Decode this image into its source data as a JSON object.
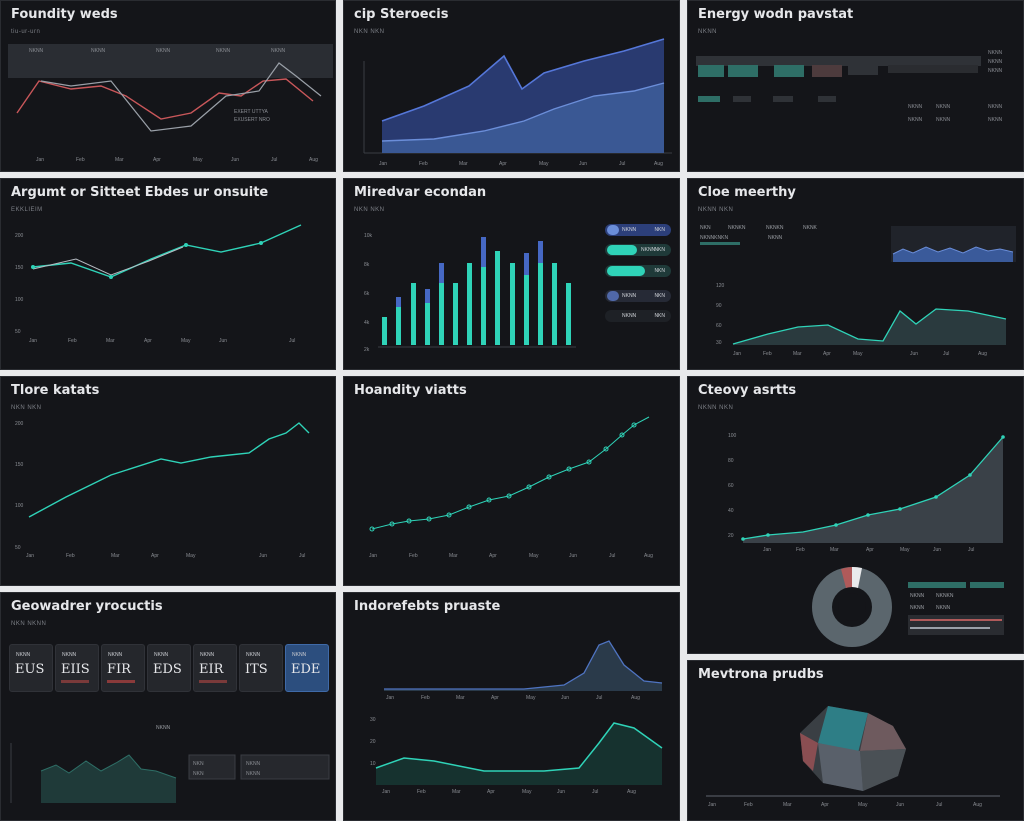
{
  "colors": {
    "bg": "#141519",
    "teal": "#2fd3b8",
    "blue": "#4668c4",
    "red": "#c9575a",
    "grid": "#2a2c31"
  },
  "panels": [
    {
      "title": "Foundity weds",
      "subtitle": "tiu-ur-urn",
      "legend": [
        "NKNN",
        "NKNN",
        "NKNN",
        "NKNN",
        "NKNN"
      ],
      "annotation": [
        "EXERT UTTYA",
        "EXUSERT NRO"
      ],
      "xticks": [
        "Jan",
        "Feb",
        "Mar",
        "Apr",
        "May",
        "Jun",
        "Jul",
        "Aug"
      ]
    },
    {
      "title": "cip Steroecis",
      "subtitle": "NKN NKN",
      "xticks": [
        "Jan",
        "Feb",
        "Mar",
        "Apr",
        "May",
        "Jun",
        "Jul",
        "Aug"
      ]
    },
    {
      "title": "Energy wodn pavstat",
      "subtitle": "NKNN",
      "right_labels": [
        "NKNN",
        "NKNN",
        "NKNN"
      ],
      "right_labels2": [
        "NKNN",
        "NKNN",
        "NKNN"
      ],
      "table_labels": [
        "NKNN",
        "NKNN",
        "NKNN"
      ]
    },
    {
      "title": "Argumt or Sitteet Ebdes ur onsuite",
      "subtitle": "EKKLIEIM",
      "yticks": [
        "200",
        "150",
        "100",
        "50"
      ],
      "xticks": [
        "Jan",
        "Feb",
        "Mar",
        "Apr",
        "May",
        "Jun",
        "Jul"
      ]
    },
    {
      "title": "Miredvar econdan",
      "subtitle": "NKN NKN",
      "yticks": [
        "10k",
        "8k",
        "6k",
        "4k",
        "2k"
      ],
      "chips": [
        {
          "label": "NKNN",
          "value": "NKN"
        },
        {
          "label": "NKNN",
          "value": "NKN"
        },
        {
          "label": "NKNN",
          "value": "NKN"
        },
        {
          "label": "NKNN",
          "value": "NKN"
        },
        {
          "label": "NKNN",
          "value": "NKN"
        }
      ]
    },
    {
      "title": "Cloe meerthy",
      "subtitle": "NKNN NKN",
      "legend": [
        "NKN",
        "NKNKN",
        "NKNKN",
        "NKNK"
      ],
      "legend_row2": [
        "NKNNKNKN",
        "NKNN"
      ],
      "xticks": [
        "Jan",
        "Feb",
        "Mar",
        "Apr",
        "May",
        "Jun",
        "Jul",
        "Aug"
      ]
    },
    {
      "title": "Tlore katats",
      "subtitle": "NKN NKN",
      "yticks": [
        "200",
        "150",
        "100",
        "50"
      ],
      "xticks": [
        "Jan",
        "Feb",
        "Mar",
        "Apr",
        "May",
        "Jun",
        "Jul"
      ]
    },
    {
      "title": "Hoandity viatts",
      "xticks": [
        "Jan",
        "Feb",
        "Mar",
        "Apr",
        "May",
        "Jun",
        "Jul",
        "Aug"
      ]
    },
    {
      "title": "Cteovy asrtts",
      "subtitle": "NKNN NKN",
      "yticks": [
        "100",
        "80",
        "60",
        "40",
        "20"
      ],
      "xticks": [
        "Jan",
        "Feb",
        "Mar",
        "Apr",
        "May",
        "Jun",
        "Jul"
      ],
      "donut_legend": [
        "NKNN",
        "NKNKN",
        "NKNN",
        "NKNN"
      ]
    },
    {
      "title": "Geowadrer yrocuctis",
      "subtitle": "NKN NKNN",
      "kpis": [
        {
          "label": "NKNN",
          "value": "EUS"
        },
        {
          "label": "NKNN",
          "value": "EIIS"
        },
        {
          "label": "NKNN",
          "value": "FIR"
        },
        {
          "label": "NKNN",
          "value": "EDS"
        },
        {
          "label": "NKNN",
          "value": "EIR"
        },
        {
          "label": "NKNN",
          "value": "ITS"
        },
        {
          "label": "NKNN",
          "value": "EDE"
        }
      ],
      "mini_label": "NKNN",
      "filters": [
        "NKN",
        "NKNN"
      ]
    },
    {
      "title": "Indorefebts pruaste",
      "xticks": [
        "Jan",
        "Feb",
        "Mar",
        "Apr",
        "May",
        "Jun",
        "Jul",
        "Aug"
      ]
    },
    {
      "title": "Mevtrona prudbs",
      "xticks": [
        "Jan",
        "Feb",
        "Mar",
        "Apr",
        "May",
        "Jun",
        "Jul",
        "Aug"
      ]
    }
  ]
}
